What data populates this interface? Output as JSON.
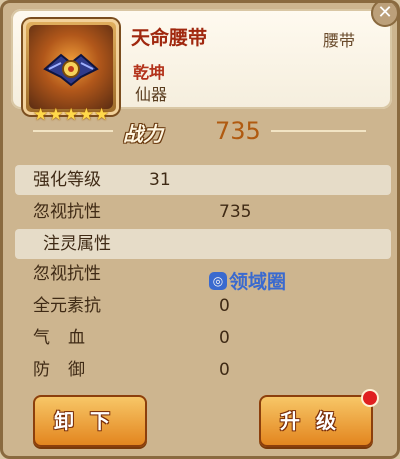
{
  "item": {
    "name": "天命腰带",
    "type": "腰带",
    "series": "乾坤",
    "grade": "仙器",
    "stars": 5,
    "icon": "belt-icon"
  },
  "power": {
    "label": "战力",
    "value": "735"
  },
  "enhance": {
    "label": "强化等级",
    "value": "31"
  },
  "stats_top": [
    {
      "label": "忽视抗性",
      "value": "735"
    }
  ],
  "spirit_section": {
    "title": "注灵属性"
  },
  "spirit_stats": [
    {
      "label": "忽视抗性",
      "value": ""
    },
    {
      "label": "全元素抗",
      "value": "0"
    },
    {
      "label": "气血",
      "value": "0"
    },
    {
      "label": "防御",
      "value": "0"
    }
  ],
  "watermark": {
    "text": "领域圈"
  },
  "buttons": {
    "unequip": "卸下",
    "upgrade": "升级"
  },
  "colors": {
    "accent": "#e2831c",
    "name": "#a0280f",
    "power": "#b05a10",
    "badge": "#e02020"
  }
}
